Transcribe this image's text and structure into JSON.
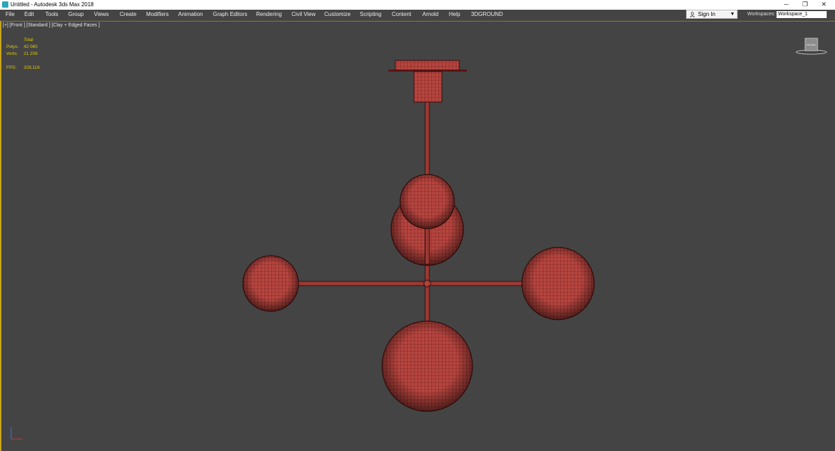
{
  "window": {
    "title": "Untitled - Autodesk 3ds Max 2018",
    "minimize_glyph": "─",
    "restore_glyph": "❐",
    "close_glyph": "✕"
  },
  "menubar": {
    "items": [
      "File",
      "Edit",
      "Tools",
      "Group",
      "Views",
      "Create",
      "Modifiers",
      "Animation",
      "Graph Editors",
      "Rendering",
      "Civil View",
      "Customize",
      "Scripting",
      "Content",
      "Arnold",
      "Help",
      "3DGROUND"
    ]
  },
  "account": {
    "signin_label": "Sign In",
    "workspaces_label": "Workspaces:",
    "workspace_value": "Workspace_1"
  },
  "viewport": {
    "label": "[+] [Front ] [Standard ] [Clay + Edged Faces ]",
    "stats": {
      "total_label": "Total",
      "polys_label": "Polys:",
      "polys_value": "42 080",
      "verts_label": "Verts:",
      "verts_value": "21 208",
      "fps_label": "FPS:",
      "fps_value": "328,116"
    },
    "viewcube_face": "FRONT"
  },
  "colors": {
    "viewport_bg": "#444444",
    "model_fill": "#b6453f",
    "model_wire": "#5a1414",
    "stats_text": "#e0c800",
    "active_border": "#c8a51d"
  }
}
